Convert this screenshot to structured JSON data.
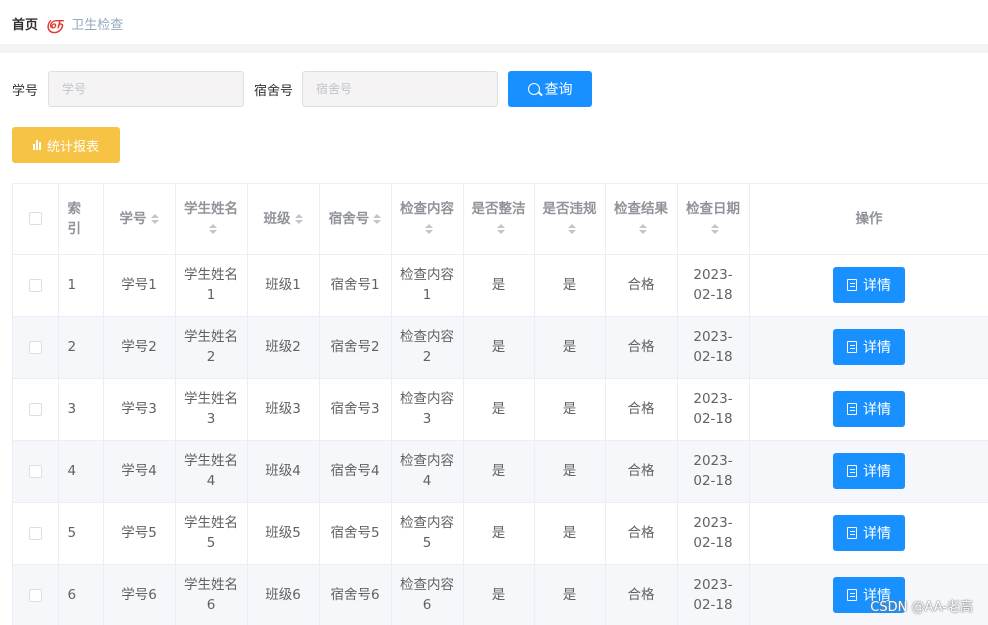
{
  "breadcrumb": {
    "home": "首页",
    "separator": "ஞ",
    "current": "卫生检查"
  },
  "search": {
    "student_no_label": "学号",
    "student_no_placeholder": "学号",
    "student_no_value": "",
    "dorm_no_label": "宿舍号",
    "dorm_no_placeholder": "宿舍号",
    "dorm_no_value": "",
    "query_label": "查询"
  },
  "report_button": "统计报表",
  "table": {
    "headers": {
      "index": "索引",
      "student_no": "学号",
      "student_name": "学生姓名",
      "class": "班级",
      "dorm_no": "宿舍号",
      "content": "检查内容",
      "clean": "是否整洁",
      "violation": "是否违规",
      "result": "检查结果",
      "date": "检查日期",
      "action": "操作"
    },
    "detail_label": "详情",
    "rows": [
      {
        "index": "1",
        "student_no": "学号1",
        "student_name": "学生姓名1",
        "class": "班级1",
        "dorm_no": "宿舍号1",
        "content": "检查内容1",
        "clean": "是",
        "violation": "是",
        "result": "合格",
        "date": "2023-02-18"
      },
      {
        "index": "2",
        "student_no": "学号2",
        "student_name": "学生姓名2",
        "class": "班级2",
        "dorm_no": "宿舍号2",
        "content": "检查内容2",
        "clean": "是",
        "violation": "是",
        "result": "合格",
        "date": "2023-02-18"
      },
      {
        "index": "3",
        "student_no": "学号3",
        "student_name": "学生姓名3",
        "class": "班级3",
        "dorm_no": "宿舍号3",
        "content": "检查内容3",
        "clean": "是",
        "violation": "是",
        "result": "合格",
        "date": "2023-02-18"
      },
      {
        "index": "4",
        "student_no": "学号4",
        "student_name": "学生姓名4",
        "class": "班级4",
        "dorm_no": "宿舍号4",
        "content": "检查内容4",
        "clean": "是",
        "violation": "是",
        "result": "合格",
        "date": "2023-02-18"
      },
      {
        "index": "5",
        "student_no": "学号5",
        "student_name": "学生姓名5",
        "class": "班级5",
        "dorm_no": "宿舍号5",
        "content": "检查内容5",
        "clean": "是",
        "violation": "是",
        "result": "合格",
        "date": "2023-02-18"
      },
      {
        "index": "6",
        "student_no": "学号6",
        "student_name": "学生姓名6",
        "class": "班级6",
        "dorm_no": "宿舍号6",
        "content": "检查内容6",
        "clean": "是",
        "violation": "是",
        "result": "合格",
        "date": "2023-02-18"
      }
    ]
  },
  "watermark": "CSDN @AA-老高",
  "icons": {
    "query": "search-icon",
    "report": "bar-chart-icon",
    "detail": "document-icon",
    "sort": "sort-caret-icon"
  },
  "colors": {
    "primary": "#1890ff",
    "warning": "#f7c344",
    "separator": "#e03c31",
    "breadcrumb_current": "#97a8be"
  }
}
